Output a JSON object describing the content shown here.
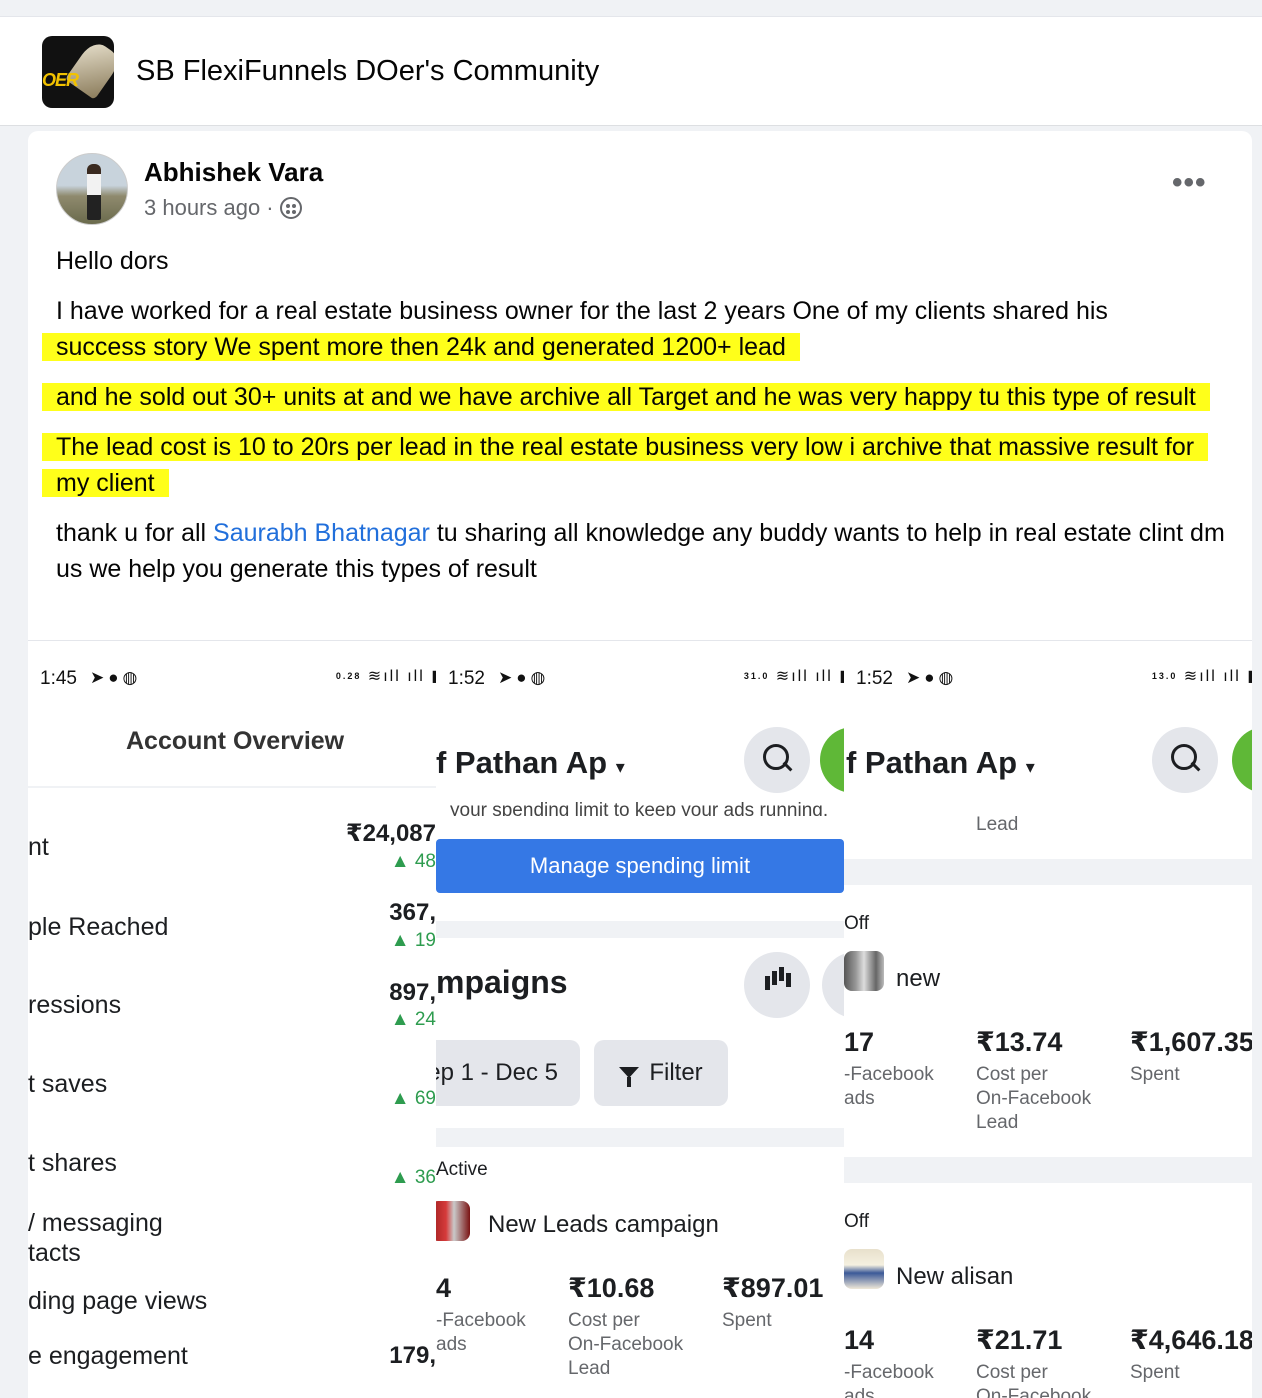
{
  "group": {
    "name": "SB FlexiFunnels DOer's Community",
    "logo_text": "OER"
  },
  "post": {
    "author": "Abhishek Vara",
    "time": "3 hours ago",
    "more": "•••",
    "greeting": "Hello dors",
    "intro": "I have worked for a real estate business owner for the last 2 years One of my clients shared his",
    "hl1": "success story We spent more then  24k and generated 1200+ lead",
    "hl2": "and he sold out 30+ units at and we have archive all Target and he was very happy tu this type of result",
    "hl3": "The lead cost is 10 to 20rs per lead in the real estate business  very low i archive that massive result for my client",
    "thanks_before": "thank u for all ",
    "mention": "Saurabh Bhatnagar",
    "thanks_after": " tu sharing all knowledge any buddy wants to help in real estate clint dm us we help you generate this types of result"
  },
  "screens": [
    {
      "time": "1:45",
      "speed": "0.28",
      "title": "Account Overview",
      "metrics": [
        {
          "label": "nt",
          "value": "₹24,087",
          "delta": "▲ 48"
        },
        {
          "label": "ple Reached",
          "value": "367,",
          "delta": "▲ 19"
        },
        {
          "label": "ressions",
          "value": "897,",
          "delta": "▲ 24"
        },
        {
          "label": "t saves",
          "value": "",
          "delta": "▲ 69"
        },
        {
          "label": "t shares",
          "value": "",
          "delta": "▲ 36"
        },
        {
          "label": "/ messaging",
          "label2": "tacts",
          "value": "",
          "delta": ""
        },
        {
          "label": "ding page views",
          "value": "",
          "delta": ""
        },
        {
          "label": "e engagement",
          "value": "179,",
          "delta": ""
        }
      ]
    },
    {
      "time": "1:52",
      "speed": "31.0",
      "title": "f Pathan Ap",
      "cut_text": "your spending limit to keep your ads running.",
      "manage_button": "Manage spending limit",
      "campaigns_title": "mpaigns",
      "date_range": "ep 1 - Dec 5",
      "filter": "Filter",
      "campaign": {
        "status": "Active",
        "name": "New Leads campaign",
        "results_value": "4",
        "results_label": [
          "-Facebook",
          "ads"
        ],
        "cpl_value": "₹10.68",
        "cpl_label": [
          "Cost per",
          "On-Facebook",
          "Lead"
        ],
        "spent_value": "₹897.01",
        "spent_label": "Spent"
      }
    },
    {
      "time": "1:52",
      "speed": "13.0",
      "title": "f Pathan Ap",
      "top_label": "Lead",
      "campaigns": [
        {
          "status": "Off",
          "name": "new",
          "results_value": "17",
          "results_label": [
            "-Facebook",
            "ads"
          ],
          "cpl_value": "₹13.74",
          "cpl_label": [
            "Cost per",
            "On-Facebook",
            "Lead"
          ],
          "spent_value": "₹1,607.35",
          "spent_label": "Spent"
        },
        {
          "status": "Off",
          "name": "New alisan",
          "results_value": "14",
          "results_label": [
            "-Facebook",
            "ads"
          ],
          "cpl_value": "₹21.71",
          "cpl_label": [
            "Cost per",
            "On-Facebook"
          ],
          "spent_value": "₹4,646.18",
          "spent_label": "Spent"
        }
      ]
    }
  ]
}
